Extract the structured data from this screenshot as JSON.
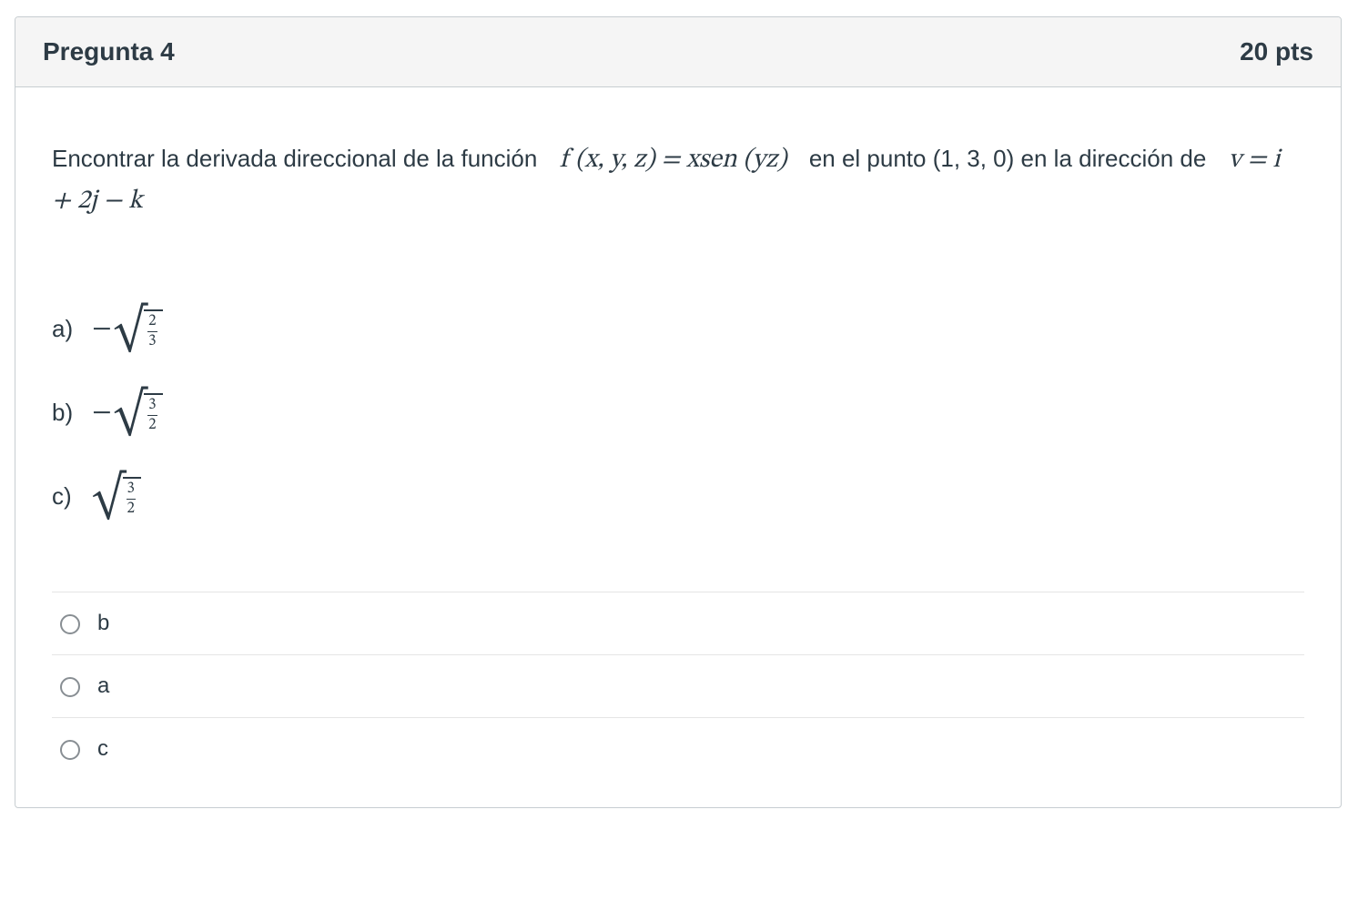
{
  "question": {
    "title": "Pregunta 4",
    "points": "20 pts",
    "stem": {
      "part1": "Encontrar la derivada direccional de la función",
      "func_expr": "f (x, y, z)  =  xsen (yz)",
      "part2": "en el punto (1, 3, 0) en la dirección de",
      "vec_expr": "v = i + 2j − k"
    },
    "options": [
      {
        "label": "a)",
        "negative": true,
        "num": "2",
        "den": "3"
      },
      {
        "label": "b)",
        "negative": true,
        "num": "3",
        "den": "2"
      },
      {
        "label": "c)",
        "negative": false,
        "num": "3",
        "den": "2"
      }
    ],
    "answers": [
      {
        "label": "b"
      },
      {
        "label": "a"
      },
      {
        "label": "c"
      }
    ]
  }
}
